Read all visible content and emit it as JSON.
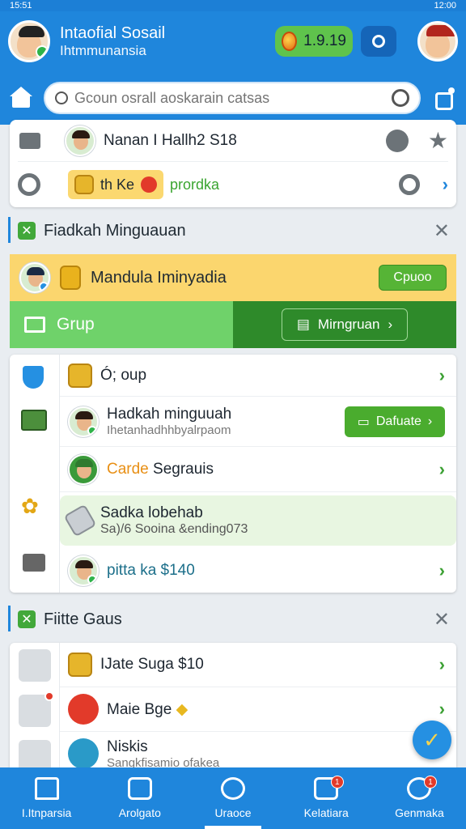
{
  "status": {
    "time": "15:51",
    "right": "12:00"
  },
  "header": {
    "title": "Intaofial Sosail",
    "subtitle": "Ihtmmunansia",
    "coins": "1.9.19"
  },
  "search": {
    "placeholder": "Gcoun osrall aoskarain catsas"
  },
  "top_card": {
    "row1_text": "Nanan I Hallh2 S18",
    "promo_a": "th Ke",
    "promo_b": "prordka"
  },
  "section1": {
    "title": "Fiadkah Minguauan"
  },
  "banner": {
    "text": "Mandula Iminyadia",
    "button": "Cpuoo"
  },
  "split": {
    "left_label": "Grup",
    "right_button": "Mirngruan"
  },
  "list1": [
    {
      "title": "Ó; oup"
    },
    {
      "title": "Hadkah minguuah",
      "sub": "Ihetanhadhhbyalrpaom",
      "button": "Dafuate"
    },
    {
      "title_orange": "Carde",
      "title_rest": "Segrauis"
    },
    {
      "title": "Sadka lobehab",
      "sub": "Sa)/6 Sooina &ending073"
    },
    {
      "title": "pitta ka $140"
    }
  ],
  "section2": {
    "title": "Fiitte Gaus"
  },
  "list2": [
    {
      "title": "IJate Suga $10"
    },
    {
      "title": "Maie Bge"
    },
    {
      "title": "Niskis",
      "sub": "Sangkfisamio ofakea"
    }
  ],
  "tabs": [
    {
      "label": "I.Itnparsia"
    },
    {
      "label": "Arolgato"
    },
    {
      "label": "Uraoce"
    },
    {
      "label": "Kelatiara",
      "badge": "1"
    },
    {
      "label": "Genmaka",
      "badge": "1"
    }
  ]
}
